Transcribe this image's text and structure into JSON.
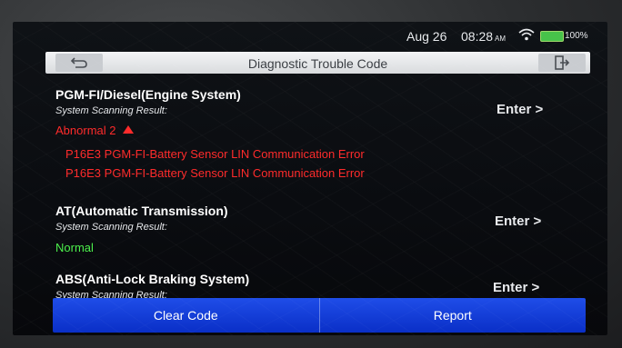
{
  "statusbar": {
    "date": "Aug 26",
    "time": "08:28",
    "ampm": "AM",
    "battery_percent": "100%",
    "icons": [
      "wifi-icon",
      "battery-icon"
    ],
    "battery_color": "#47c24a"
  },
  "header": {
    "title": "Diagnostic Trouble Code",
    "left_icon": "back-arrow-icon",
    "right_icon": "exit-icon"
  },
  "systems": [
    {
      "name": "PGM-FI/Diesel(Engine System)",
      "subtitle": "System Scanning Result:",
      "enter_label": "Enter >",
      "status": "Abnormal 2",
      "status_color": "#ff2b2b",
      "codes": [
        "P16E3 PGM-FI-Battery Sensor LIN Communication Error",
        "P16E3 PGM-FI-Battery Sensor LIN Communication Error"
      ]
    },
    {
      "name": "AT(Automatic Transmission)",
      "subtitle": "System Scanning Result:",
      "enter_label": "Enter >",
      "status": "Normal",
      "status_color": "#4cf04c",
      "codes": []
    },
    {
      "name": "ABS(Anti-Lock Braking System)",
      "subtitle": "System Scanning Result:",
      "enter_label": "Enter >",
      "status": "",
      "codes": []
    }
  ],
  "actions": {
    "clear_code": "Clear Code",
    "report": "Report",
    "accent": "#1f4de8"
  }
}
